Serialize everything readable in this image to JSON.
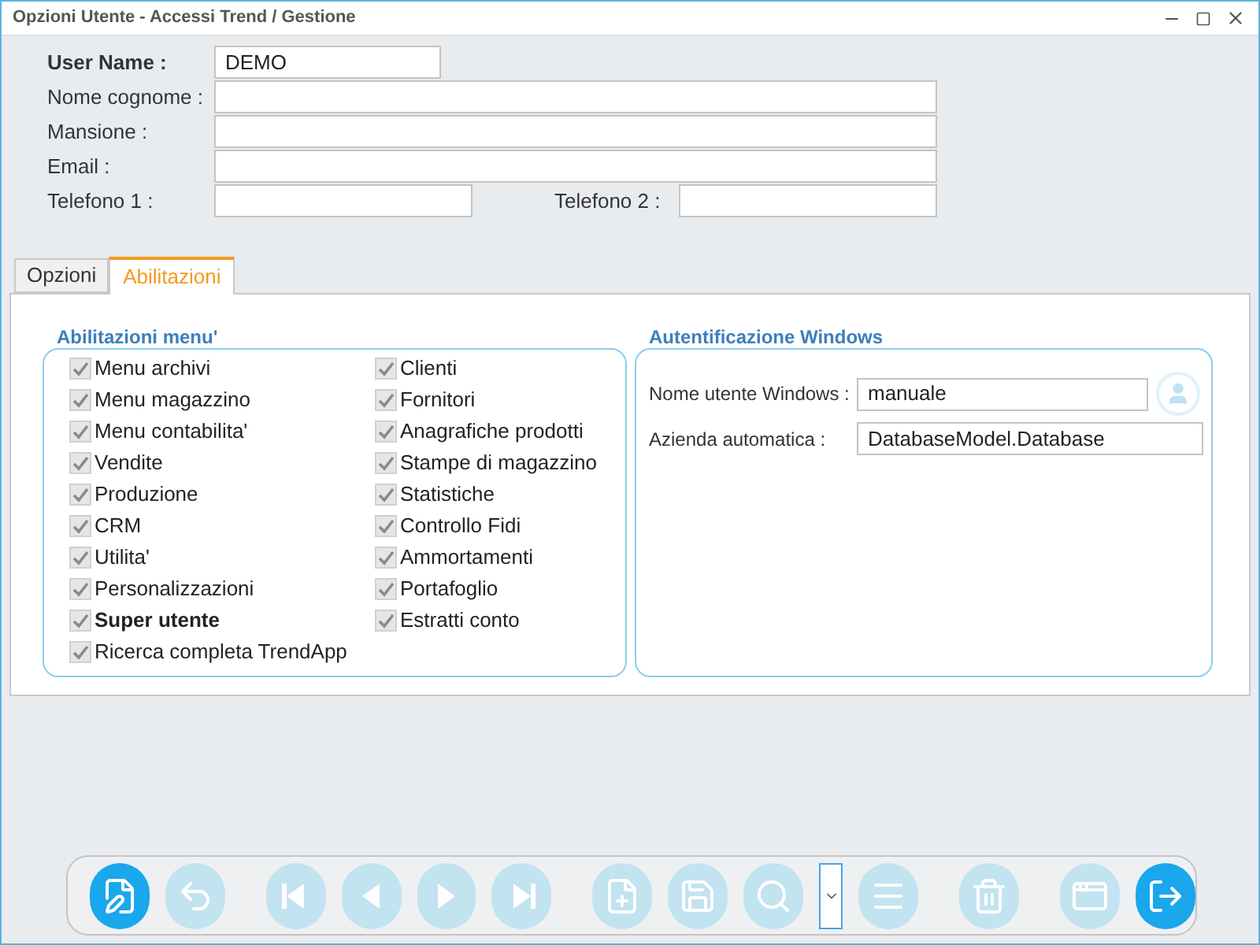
{
  "window": {
    "title": "Opzioni Utente - Accessi Trend / Gestione"
  },
  "form": {
    "user_name": {
      "label": "User Name :",
      "value": "DEMO"
    },
    "fields": [
      {
        "label": "Nome cognome :"
      },
      {
        "label": "Mansione :"
      },
      {
        "label": "Email :"
      }
    ],
    "telefono_1": {
      "label": "Telefono 1 :"
    },
    "telefono_2": {
      "label": "Telefono 2 :"
    }
  },
  "tabs": [
    {
      "label": "Opzioni",
      "selected": false
    },
    {
      "label": "Abilitazioni",
      "selected": true
    }
  ],
  "menu_group": {
    "title": "Abilitazioni menu'",
    "column_1": [
      {
        "label": "Menu archivi",
        "checked": true,
        "bold": false
      },
      {
        "label": "Menu magazzino",
        "checked": true,
        "bold": false
      },
      {
        "label": "Menu contabilita'",
        "checked": true,
        "bold": false
      },
      {
        "label": "Vendite",
        "checked": true,
        "bold": false
      },
      {
        "label": "Produzione",
        "checked": true,
        "bold": false
      },
      {
        "label": "CRM",
        "checked": true,
        "bold": false
      },
      {
        "label": "Utilita'",
        "checked": true,
        "bold": false
      },
      {
        "label": "Personalizzazioni",
        "checked": true,
        "bold": false
      },
      {
        "label": "Super utente",
        "checked": true,
        "bold": true
      },
      {
        "label": "Ricerca completa TrendApp",
        "checked": true,
        "bold": false
      }
    ],
    "column_2": [
      {
        "label": "Clienti",
        "checked": true,
        "bold": false
      },
      {
        "label": "Fornitori",
        "checked": true,
        "bold": false
      },
      {
        "label": "Anagrafiche prodotti",
        "checked": true,
        "bold": false
      },
      {
        "label": "Stampe di magazzino",
        "checked": true,
        "bold": false
      },
      {
        "label": "Statistiche",
        "checked": true,
        "bold": false
      },
      {
        "label": "Controllo Fidi",
        "checked": true,
        "bold": false
      },
      {
        "label": "Ammortamenti",
        "checked": true,
        "bold": false
      },
      {
        "label": "Portafoglio",
        "checked": true,
        "bold": false
      },
      {
        "label": "Estratti conto",
        "checked": true,
        "bold": false
      }
    ]
  },
  "windows_group": {
    "title": "Autentificazione Windows",
    "nome_utente": {
      "label": "Nome utente Windows :",
      "value": "manuale"
    },
    "azienda": {
      "label": "Azienda automatica :",
      "value": "DatabaseModel.Database"
    }
  },
  "toolbar": [
    {
      "kind": "edit",
      "disabled": false
    },
    {
      "kind": "undo",
      "disabled": true
    },
    {
      "kind": "first",
      "disabled": true
    },
    {
      "kind": "prev",
      "disabled": true
    },
    {
      "kind": "next",
      "disabled": true
    },
    {
      "kind": "last",
      "disabled": true
    },
    {
      "kind": "new",
      "disabled": true
    },
    {
      "kind": "save",
      "disabled": true
    },
    {
      "kind": "search",
      "disabled": true
    },
    {
      "kind": "dropdown",
      "disabled": false
    },
    {
      "kind": "list",
      "disabled": true
    },
    {
      "kind": "delete",
      "disabled": true
    },
    {
      "kind": "window",
      "disabled": true
    },
    {
      "kind": "exit",
      "disabled": false
    }
  ]
}
